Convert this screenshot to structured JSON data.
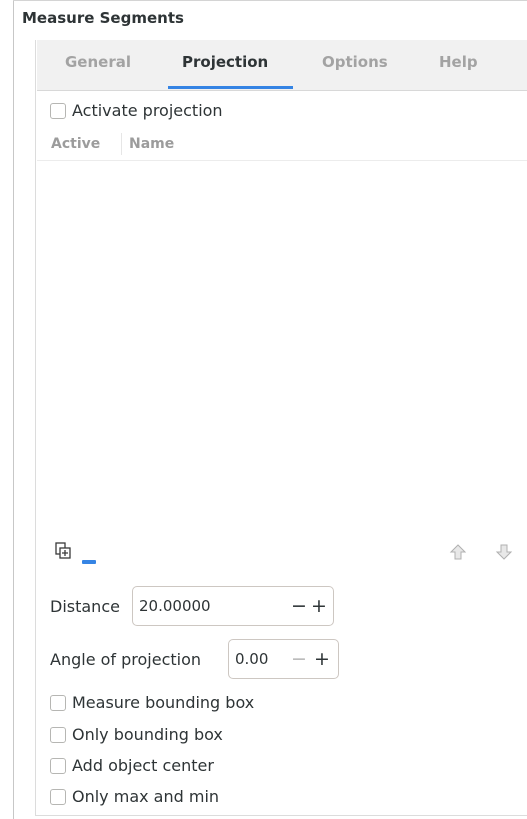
{
  "panel": {
    "title": "Measure Segments"
  },
  "tabs": [
    {
      "label": "General",
      "active": false
    },
    {
      "label": "Projection",
      "active": true
    },
    {
      "label": "Options",
      "active": false
    },
    {
      "label": "Help",
      "active": false
    }
  ],
  "projection": {
    "activate_label": "Activate projection",
    "activate_checked": false,
    "columns": [
      "Active",
      "Name"
    ],
    "rows": [],
    "toolbar": {
      "add_icon": "add-path-icon",
      "remove_icon": "remove-icon",
      "move_up_icon": "move-up-icon",
      "move_down_icon": "move-down-icon"
    },
    "distance_label": "Distance",
    "distance_value": "20.00000",
    "angle_label": "Angle of projection",
    "angle_value": "0.00",
    "options": [
      {
        "label": "Measure bounding box",
        "checked": false
      },
      {
        "label": "Only bounding box",
        "checked": false
      },
      {
        "label": "Add object center",
        "checked": false
      },
      {
        "label": "Only max and min",
        "checked": false
      }
    ],
    "spin_minus": "−",
    "spin_plus": "+"
  },
  "colors": {
    "accent": "#3584e4",
    "tab_bg": "#f1f1f1",
    "text": "#2e3436",
    "muted": "#a3a3a3"
  }
}
